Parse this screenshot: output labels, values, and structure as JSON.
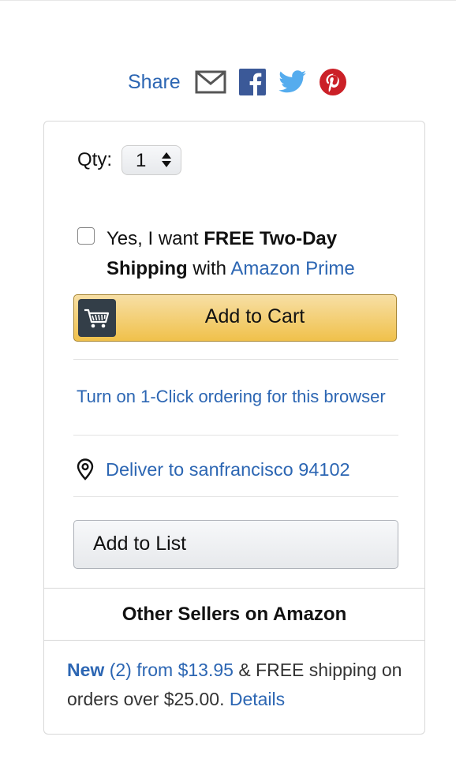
{
  "share": {
    "label": "Share",
    "icons": [
      "email-icon",
      "facebook-icon",
      "twitter-icon",
      "pinterest-icon"
    ],
    "colors": {
      "facebook": "#3b5998",
      "twitter": "#55acee",
      "pinterest": "#cb2027",
      "email": "#555555"
    }
  },
  "qty": {
    "label": "Qty:",
    "value": "1"
  },
  "prime": {
    "text_start": "Yes, I want ",
    "bold_1": "FREE Two-Day",
    "bold_2": "Shipping",
    "text_mid": " with ",
    "link": "Amazon Prime",
    "checked": false
  },
  "cart": {
    "label": "Add to Cart",
    "icon": "cart-icon"
  },
  "oneclick": {
    "label": "Turn on 1-Click ordering for this browser"
  },
  "deliver": {
    "label": "Deliver to sanfrancisco 94102",
    "icon": "location-pin-icon"
  },
  "list": {
    "label": "Add to List"
  },
  "sellers": {
    "heading": "Other Sellers on Amazon",
    "new_label": "New",
    "count": "(2) from",
    "price": "$13.95",
    "shipping": " & FREE shipping on orders over $25.00. ",
    "details": "Details"
  },
  "colors": {
    "link": "#2c66b3",
    "cart_button": "#f0c14b",
    "cart_border": "#a88734"
  }
}
